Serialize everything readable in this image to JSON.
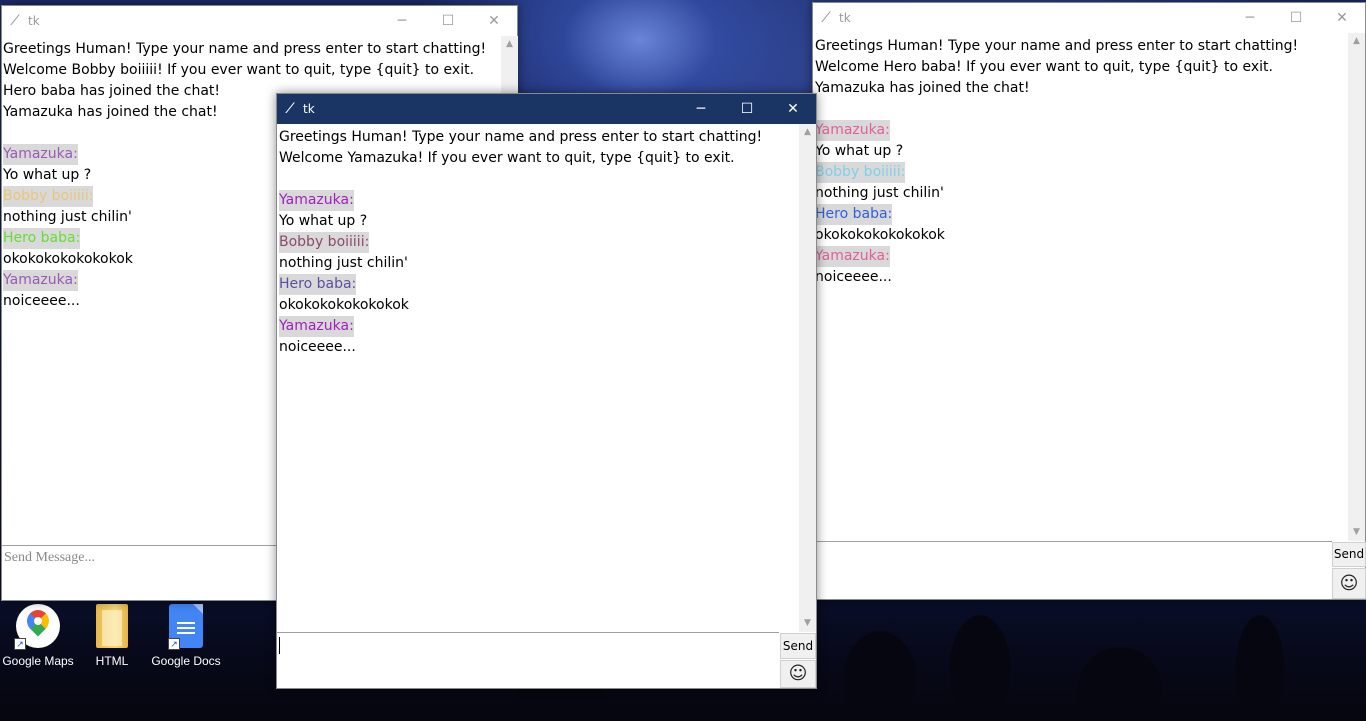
{
  "window_title": "tk",
  "controls": {
    "minimize": "─",
    "maximize": "☐",
    "close": "✕"
  },
  "desktop_icons": [
    {
      "label": "Google Maps"
    },
    {
      "label": "HTML"
    },
    {
      "label": "Google Docs"
    }
  ],
  "win_bobby": {
    "lines": [
      {
        "text": "Greetings Human! Type your name and press enter to start chatting!"
      },
      {
        "text": "Welcome Bobby boiiiii! If you ever want to quit, type {quit} to exit."
      },
      {
        "text": "Hero baba has joined the chat!"
      },
      {
        "text": "Yamazuka has joined the chat!"
      },
      {
        "text": ""
      },
      {
        "text": "Yamazuka:",
        "user": true,
        "color": "#9b59b6"
      },
      {
        "text": "Yo what up ?"
      },
      {
        "text": "Bobby boiiiii:",
        "user": true,
        "color": "#e8c77a"
      },
      {
        "text": "nothing just chilin'"
      },
      {
        "text": "Hero baba:",
        "user": true,
        "color": "#66dd33"
      },
      {
        "text": "okokokokokokokok"
      },
      {
        "text": "Yamazuka:",
        "user": true,
        "color": "#9b59b6"
      },
      {
        "text": "noiceeee..."
      }
    ],
    "input_placeholder": "Send Message..."
  },
  "win_hero": {
    "lines": [
      {
        "text": "Greetings Human! Type your name and press enter to start chatting!"
      },
      {
        "text": "Welcome Hero baba! If you ever want to quit, type {quit} to exit."
      },
      {
        "text": "Yamazuka has joined the chat!"
      },
      {
        "text": ""
      },
      {
        "text": "Yamazuka:",
        "user": true,
        "color": "#e0609a"
      },
      {
        "text": "Yo what up ?"
      },
      {
        "text": "Bobby boiiiii:",
        "user": true,
        "color": "#7fd0e8"
      },
      {
        "text": "nothing just chilin'"
      },
      {
        "text": "Hero baba:",
        "user": true,
        "color": "#3060e0"
      },
      {
        "text": "okokokokokokokok"
      },
      {
        "text": "Yamazuka:",
        "user": true,
        "color": "#e0609a"
      },
      {
        "text": "noiceeee..."
      }
    ],
    "send_label": "Send",
    "emoji": "☺"
  },
  "win_yamazuka": {
    "lines": [
      {
        "text": "Greetings Human! Type your name and press enter to start chatting!"
      },
      {
        "text": "Welcome Yamazuka! If you ever want to quit, type {quit} to exit."
      },
      {
        "text": ""
      },
      {
        "text": "Yamazuka:",
        "user": true,
        "color": "#a020c0"
      },
      {
        "text": "Yo what up ?"
      },
      {
        "text": "Bobby boiiiii:",
        "user": true,
        "color": "#8a4a6a"
      },
      {
        "text": "nothing just chilin'"
      },
      {
        "text": "Hero baba:",
        "user": true,
        "color": "#5a50a0"
      },
      {
        "text": "okokokokokokokok"
      },
      {
        "text": "Yamazuka:",
        "user": true,
        "color": "#a020c0"
      },
      {
        "text": "noiceeee..."
      }
    ],
    "input_value": "",
    "send_label": "Send",
    "emoji": "☺"
  }
}
